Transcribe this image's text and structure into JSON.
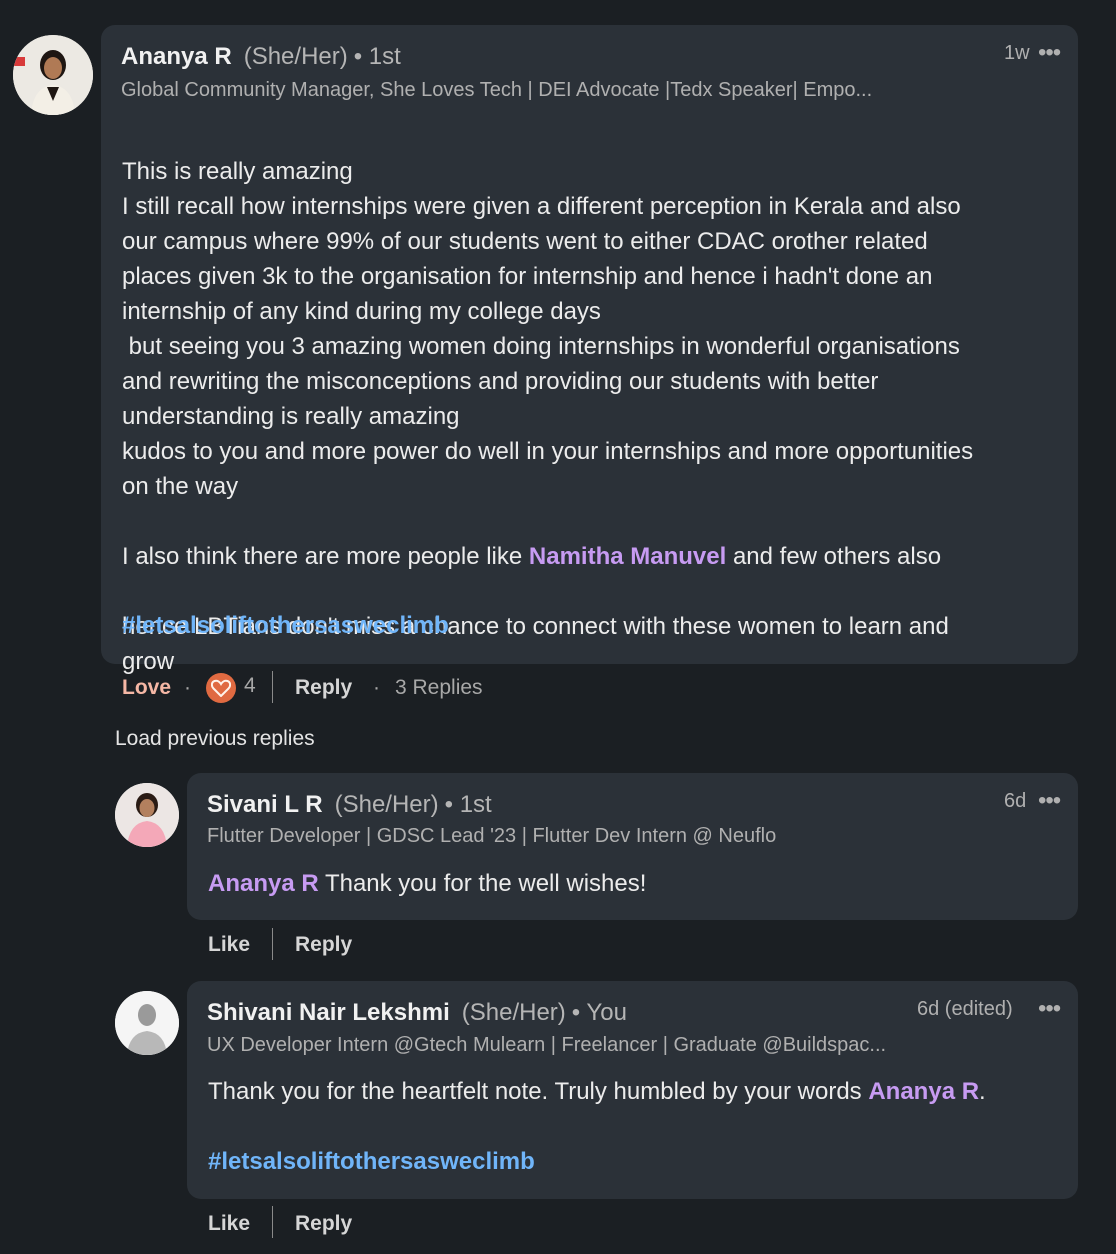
{
  "comment": {
    "author": "Ananya R",
    "pronouns": "(She/Her)",
    "degree": "• 1st",
    "headline": "Global Community Manager, She Loves Tech | DEI Advocate |Tedx Speaker| Empo...",
    "time": "1w",
    "more": "•••",
    "lines": [
      "This is really amazing",
      "I still recall how internships were given a different perception in Kerala and also",
      "our campus where 99% of our students went to either CDAC orother related",
      "places given 3k to the organisation for internship and hence i hadn't done an",
      "internship of any kind during my college days",
      " but seeing you 3 amazing women doing internships in wonderful organisations",
      "and rewriting the misconceptions and providing our students with better",
      "understanding is really amazing",
      "kudos to you and more power do well in your internships and more opportunities",
      "on the way"
    ],
    "mention_pre": "I also think there are more people like ",
    "mention": "Namitha Manuvel",
    "mention_post": " and few others also",
    "lines_after": [
      "hence LBTians don't miss a chance to connect with these women to learn and",
      "grow"
    ],
    "hashtag": "#letsalsoliftothersasweclimb",
    "reaction_label": "Love",
    "reaction_sep": "·",
    "reaction_count": "4",
    "reply_label": "Reply",
    "replies_sep": "·",
    "replies_count": "3 Replies"
  },
  "load_previous": "Load previous replies",
  "replies": [
    {
      "author": "Sivani L R",
      "pronouns": "(She/Her)",
      "degree": "• 1st",
      "headline": "Flutter Developer | GDSC Lead '23 | Flutter Dev Intern @ Neuflo",
      "time": "6d",
      "more": "•••",
      "mention": "Ananya R",
      "text_after": " Thank you for the well wishes!",
      "like_label": "Like",
      "reply_label": "Reply"
    },
    {
      "author": "Shivani Nair Lekshmi",
      "pronouns": "(She/Her)",
      "degree": "• You",
      "headline": "UX Developer Intern @Gtech Mulearn | Freelancer | Graduate @Buildspac...",
      "time": "6d (edited)",
      "more": "•••",
      "text_before": "Thank you for the heartfelt note. Truly humbled by your words ",
      "mention": "Ananya R",
      "text_end": ".",
      "hashtag": "#letsalsoliftothersasweclimb",
      "like_label": "Like",
      "reply_label": "Reply"
    }
  ],
  "colors": {
    "background": "#1b1f23",
    "bubble": "#2b3138",
    "mention": "#c79bf2",
    "hashtag": "#70b5f9",
    "love": "#f5b7a5",
    "love_icon": "#e06a41"
  }
}
